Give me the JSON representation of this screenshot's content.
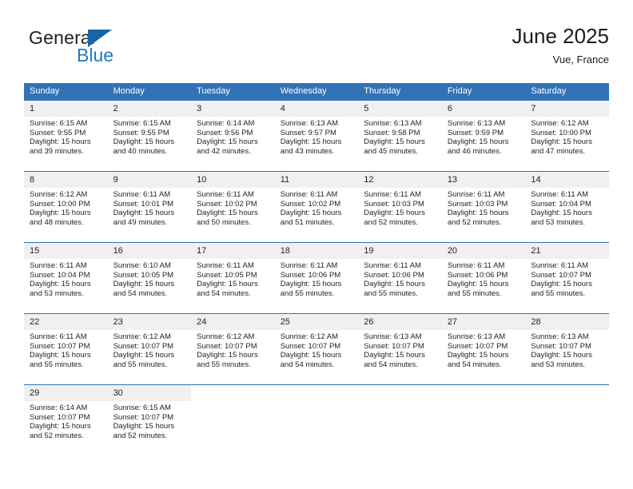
{
  "brand": {
    "name_part1": "General",
    "name_part2": "Blue",
    "flag_color": "#1565a8",
    "blue_color": "#1f7ac0"
  },
  "header": {
    "title": "June 2025",
    "subtitle": "Vue, France",
    "accent_color": "#3173b5",
    "daynum_band_color": "#f0f0f0"
  },
  "calendar": {
    "weekday_headers": [
      "Sunday",
      "Monday",
      "Tuesday",
      "Wednesday",
      "Thursday",
      "Friday",
      "Saturday"
    ],
    "weeks": [
      [
        {
          "day": "1",
          "sunrise": "Sunrise: 6:15 AM",
          "sunset": "Sunset: 9:55 PM",
          "daylight_line1": "Daylight: 15 hours",
          "daylight_line2": "and 39 minutes."
        },
        {
          "day": "2",
          "sunrise": "Sunrise: 6:15 AM",
          "sunset": "Sunset: 9:55 PM",
          "daylight_line1": "Daylight: 15 hours",
          "daylight_line2": "and 40 minutes."
        },
        {
          "day": "3",
          "sunrise": "Sunrise: 6:14 AM",
          "sunset": "Sunset: 9:56 PM",
          "daylight_line1": "Daylight: 15 hours",
          "daylight_line2": "and 42 minutes."
        },
        {
          "day": "4",
          "sunrise": "Sunrise: 6:13 AM",
          "sunset": "Sunset: 9:57 PM",
          "daylight_line1": "Daylight: 15 hours",
          "daylight_line2": "and 43 minutes."
        },
        {
          "day": "5",
          "sunrise": "Sunrise: 6:13 AM",
          "sunset": "Sunset: 9:58 PM",
          "daylight_line1": "Daylight: 15 hours",
          "daylight_line2": "and 45 minutes."
        },
        {
          "day": "6",
          "sunrise": "Sunrise: 6:13 AM",
          "sunset": "Sunset: 9:59 PM",
          "daylight_line1": "Daylight: 15 hours",
          "daylight_line2": "and 46 minutes."
        },
        {
          "day": "7",
          "sunrise": "Sunrise: 6:12 AM",
          "sunset": "Sunset: 10:00 PM",
          "daylight_line1": "Daylight: 15 hours",
          "daylight_line2": "and 47 minutes."
        }
      ],
      [
        {
          "day": "8",
          "sunrise": "Sunrise: 6:12 AM",
          "sunset": "Sunset: 10:00 PM",
          "daylight_line1": "Daylight: 15 hours",
          "daylight_line2": "and 48 minutes."
        },
        {
          "day": "9",
          "sunrise": "Sunrise: 6:11 AM",
          "sunset": "Sunset: 10:01 PM",
          "daylight_line1": "Daylight: 15 hours",
          "daylight_line2": "and 49 minutes."
        },
        {
          "day": "10",
          "sunrise": "Sunrise: 6:11 AM",
          "sunset": "Sunset: 10:02 PM",
          "daylight_line1": "Daylight: 15 hours",
          "daylight_line2": "and 50 minutes."
        },
        {
          "day": "11",
          "sunrise": "Sunrise: 6:11 AM",
          "sunset": "Sunset: 10:02 PM",
          "daylight_line1": "Daylight: 15 hours",
          "daylight_line2": "and 51 minutes."
        },
        {
          "day": "12",
          "sunrise": "Sunrise: 6:11 AM",
          "sunset": "Sunset: 10:03 PM",
          "daylight_line1": "Daylight: 15 hours",
          "daylight_line2": "and 52 minutes."
        },
        {
          "day": "13",
          "sunrise": "Sunrise: 6:11 AM",
          "sunset": "Sunset: 10:03 PM",
          "daylight_line1": "Daylight: 15 hours",
          "daylight_line2": "and 52 minutes."
        },
        {
          "day": "14",
          "sunrise": "Sunrise: 6:11 AM",
          "sunset": "Sunset: 10:04 PM",
          "daylight_line1": "Daylight: 15 hours",
          "daylight_line2": "and 53 minutes."
        }
      ],
      [
        {
          "day": "15",
          "sunrise": "Sunrise: 6:11 AM",
          "sunset": "Sunset: 10:04 PM",
          "daylight_line1": "Daylight: 15 hours",
          "daylight_line2": "and 53 minutes."
        },
        {
          "day": "16",
          "sunrise": "Sunrise: 6:10 AM",
          "sunset": "Sunset: 10:05 PM",
          "daylight_line1": "Daylight: 15 hours",
          "daylight_line2": "and 54 minutes."
        },
        {
          "day": "17",
          "sunrise": "Sunrise: 6:11 AM",
          "sunset": "Sunset: 10:05 PM",
          "daylight_line1": "Daylight: 15 hours",
          "daylight_line2": "and 54 minutes."
        },
        {
          "day": "18",
          "sunrise": "Sunrise: 6:11 AM",
          "sunset": "Sunset: 10:06 PM",
          "daylight_line1": "Daylight: 15 hours",
          "daylight_line2": "and 55 minutes."
        },
        {
          "day": "19",
          "sunrise": "Sunrise: 6:11 AM",
          "sunset": "Sunset: 10:06 PM",
          "daylight_line1": "Daylight: 15 hours",
          "daylight_line2": "and 55 minutes."
        },
        {
          "day": "20",
          "sunrise": "Sunrise: 6:11 AM",
          "sunset": "Sunset: 10:06 PM",
          "daylight_line1": "Daylight: 15 hours",
          "daylight_line2": "and 55 minutes."
        },
        {
          "day": "21",
          "sunrise": "Sunrise: 6:11 AM",
          "sunset": "Sunset: 10:07 PM",
          "daylight_line1": "Daylight: 15 hours",
          "daylight_line2": "and 55 minutes."
        }
      ],
      [
        {
          "day": "22",
          "sunrise": "Sunrise: 6:11 AM",
          "sunset": "Sunset: 10:07 PM",
          "daylight_line1": "Daylight: 15 hours",
          "daylight_line2": "and 55 minutes."
        },
        {
          "day": "23",
          "sunrise": "Sunrise: 6:12 AM",
          "sunset": "Sunset: 10:07 PM",
          "daylight_line1": "Daylight: 15 hours",
          "daylight_line2": "and 55 minutes."
        },
        {
          "day": "24",
          "sunrise": "Sunrise: 6:12 AM",
          "sunset": "Sunset: 10:07 PM",
          "daylight_line1": "Daylight: 15 hours",
          "daylight_line2": "and 55 minutes."
        },
        {
          "day": "25",
          "sunrise": "Sunrise: 6:12 AM",
          "sunset": "Sunset: 10:07 PM",
          "daylight_line1": "Daylight: 15 hours",
          "daylight_line2": "and 54 minutes."
        },
        {
          "day": "26",
          "sunrise": "Sunrise: 6:13 AM",
          "sunset": "Sunset: 10:07 PM",
          "daylight_line1": "Daylight: 15 hours",
          "daylight_line2": "and 54 minutes."
        },
        {
          "day": "27",
          "sunrise": "Sunrise: 6:13 AM",
          "sunset": "Sunset: 10:07 PM",
          "daylight_line1": "Daylight: 15 hours",
          "daylight_line2": "and 54 minutes."
        },
        {
          "day": "28",
          "sunrise": "Sunrise: 6:13 AM",
          "sunset": "Sunset: 10:07 PM",
          "daylight_line1": "Daylight: 15 hours",
          "daylight_line2": "and 53 minutes."
        }
      ],
      [
        {
          "day": "29",
          "sunrise": "Sunrise: 6:14 AM",
          "sunset": "Sunset: 10:07 PM",
          "daylight_line1": "Daylight: 15 hours",
          "daylight_line2": "and 52 minutes."
        },
        {
          "day": "30",
          "sunrise": "Sunrise: 6:15 AM",
          "sunset": "Sunset: 10:07 PM",
          "daylight_line1": "Daylight: 15 hours",
          "daylight_line2": "and 52 minutes."
        },
        {
          "day": "",
          "sunrise": "",
          "sunset": "",
          "daylight_line1": "",
          "daylight_line2": ""
        },
        {
          "day": "",
          "sunrise": "",
          "sunset": "",
          "daylight_line1": "",
          "daylight_line2": ""
        },
        {
          "day": "",
          "sunrise": "",
          "sunset": "",
          "daylight_line1": "",
          "daylight_line2": ""
        },
        {
          "day": "",
          "sunrise": "",
          "sunset": "",
          "daylight_line1": "",
          "daylight_line2": ""
        },
        {
          "day": "",
          "sunrise": "",
          "sunset": "",
          "daylight_line1": "",
          "daylight_line2": ""
        }
      ]
    ]
  }
}
